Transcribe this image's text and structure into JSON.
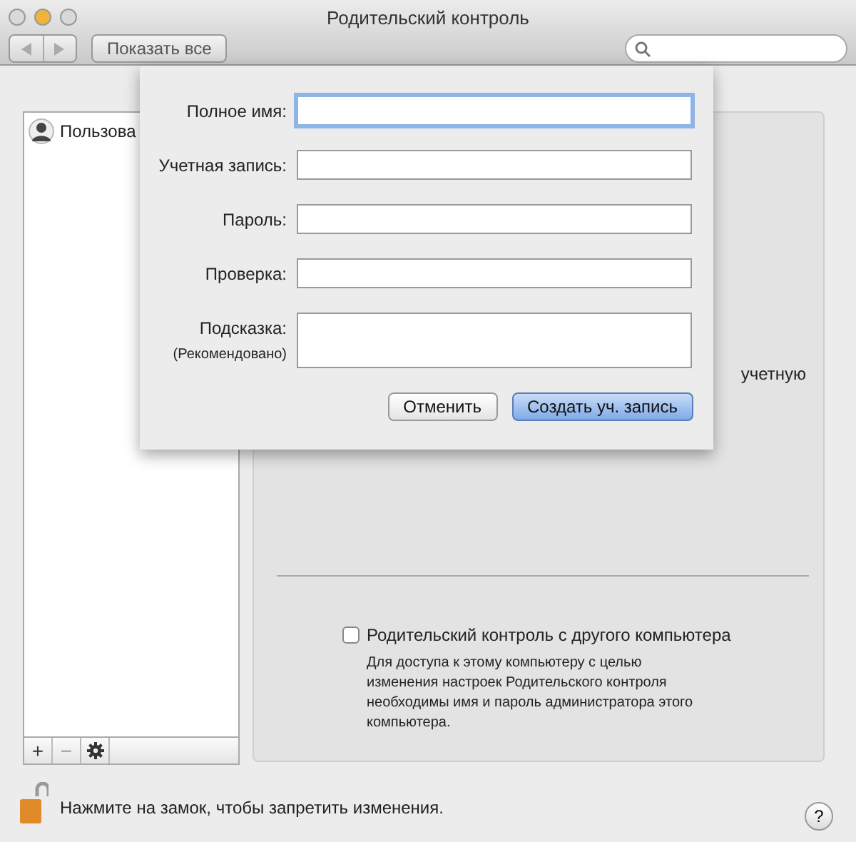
{
  "window": {
    "title": "Родительский контроль"
  },
  "toolbar": {
    "show_all": "Показать все"
  },
  "sidebar": {
    "items": [
      {
        "label": "Пользова"
      }
    ],
    "add": "+",
    "remove": "−"
  },
  "panel": {
    "note_fragment": "учетную",
    "remote": {
      "label": "Родительский контроль с другого компьютера",
      "checked": false,
      "description": "Для доступа к этому компьютеру с целью изменения настроек Родительского контроля необходимы имя и пароль администратора этого компьютера."
    }
  },
  "lock": {
    "text": "Нажмите на замок, чтобы запретить изменения.",
    "locked": false
  },
  "help": "?",
  "sheet": {
    "fields": [
      {
        "label": "Полное имя:",
        "kind": "line",
        "focused": true
      },
      {
        "label": "Учетная запись:",
        "kind": "line",
        "focused": false
      },
      {
        "label": "Пароль:",
        "kind": "line",
        "focused": false
      },
      {
        "label": "Проверка:",
        "kind": "line",
        "focused": false
      },
      {
        "label": "Подсказка:",
        "sublabel": "(Рекомендовано)",
        "kind": "multiline",
        "focused": false
      }
    ],
    "buttons": [
      {
        "label": "Отменить",
        "default": false
      },
      {
        "label": "Создать уч. запись",
        "default": true
      }
    ]
  }
}
